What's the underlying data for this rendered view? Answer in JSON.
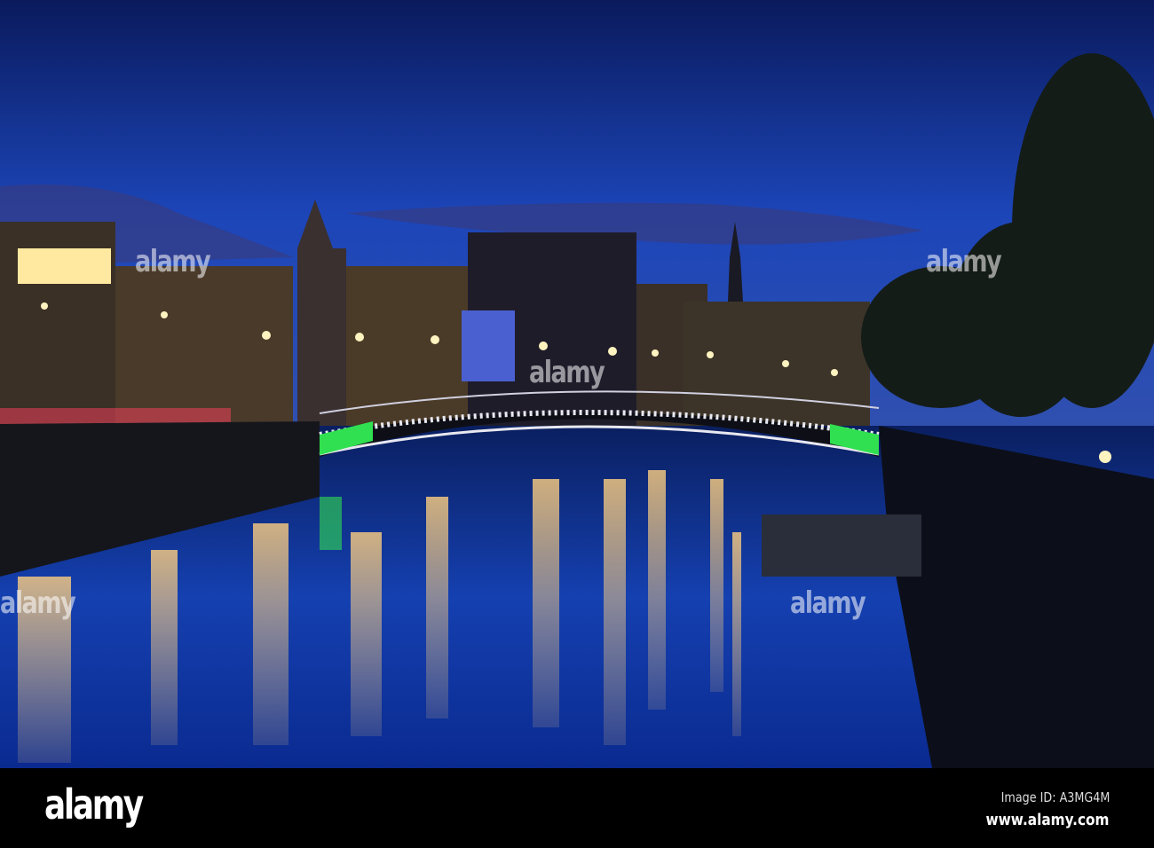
{
  "photo": {
    "subject": "Ha'penny Bridge over the River Liffey at dusk"
  },
  "watermark": {
    "text": "alamy"
  },
  "footer": {
    "logo": "alamy",
    "image_id": "Image ID: A3MG4M",
    "website": "www.alamy.com"
  },
  "colors": {
    "sky_top": "#0a1a5c",
    "sky_mid": "#1e4fc8",
    "water": "#0b2a8a",
    "bridge_green": "#2fe050"
  }
}
